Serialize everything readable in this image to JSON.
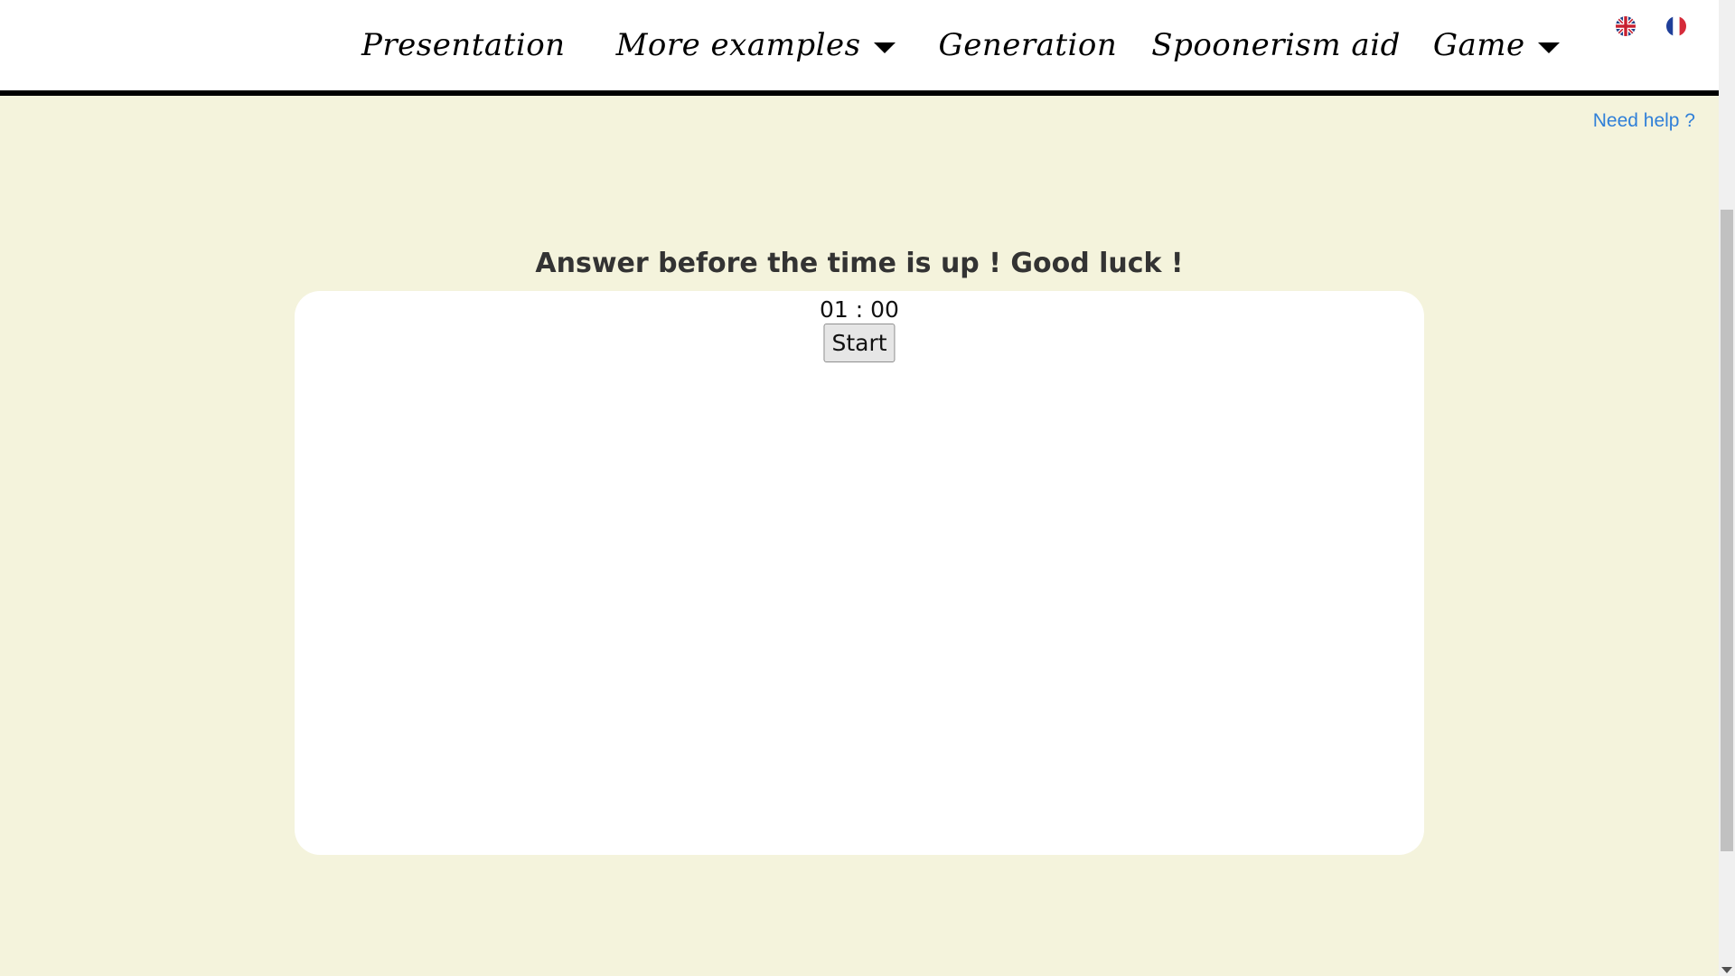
{
  "nav": {
    "items": [
      {
        "label": "Presentation",
        "has_dropdown": false
      },
      {
        "label": "More examples",
        "has_dropdown": true
      },
      {
        "label": "Generation",
        "has_dropdown": false
      },
      {
        "label": "Spoonerism aid",
        "has_dropdown": false
      },
      {
        "label": "Game",
        "has_dropdown": true
      }
    ],
    "languages": [
      {
        "icon": "uk-flag-icon"
      },
      {
        "icon": "france-flag-icon"
      }
    ]
  },
  "help": {
    "label": "Need help ?"
  },
  "game": {
    "heading": "Answer before the time is up ! Good luck !",
    "timer": "01 : 00",
    "start_label": "Start"
  },
  "colors": {
    "background": "#f4f3dc",
    "link": "#2f7fd8",
    "nav_border": "#000000"
  }
}
